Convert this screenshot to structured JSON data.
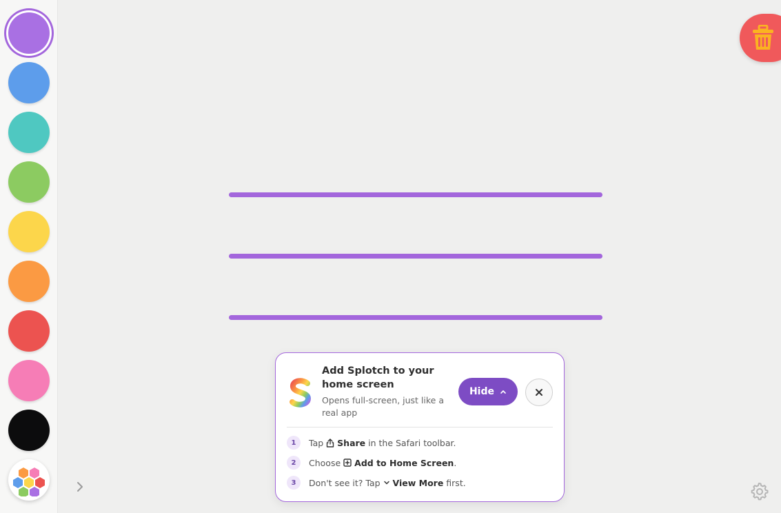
{
  "palette": {
    "swatches": [
      {
        "name": "purple",
        "color": "#a970e3",
        "selected": true
      },
      {
        "name": "blue",
        "color": "#5d9deb"
      },
      {
        "name": "teal",
        "color": "#4fc8c1"
      },
      {
        "name": "green",
        "color": "#8ccb61"
      },
      {
        "name": "yellow",
        "color": "#fcd64b"
      },
      {
        "name": "orange",
        "color": "#fb9a43"
      },
      {
        "name": "red",
        "color": "#ec5350"
      },
      {
        "name": "pink",
        "color": "#f67db6"
      },
      {
        "name": "black",
        "color": "#0c0c0d"
      }
    ],
    "custom_swatch_icon": "hexagon-color-wheel-icon",
    "expand_icon": "chevron-right-icon"
  },
  "canvas": {
    "stroke_color": "#a366dc",
    "strokes": 3
  },
  "trash": {
    "icon": "trash-icon",
    "color": "#f0595b",
    "icon_color": "#fbb321"
  },
  "settings": {
    "icon": "gear-icon"
  },
  "install_card": {
    "title": "Add Splotch to your home screen",
    "subtitle": "Opens full-screen, just like a real app",
    "hide_label": "Hide",
    "close_icon": "close-icon",
    "steps": [
      {
        "num": "1",
        "pre": "Tap",
        "icon": "share-icon",
        "bold": "Share",
        "post": "in the Safari toolbar."
      },
      {
        "num": "2",
        "pre": "Choose",
        "icon": "add-square-icon",
        "bold": "Add to Home Screen",
        "post": "."
      },
      {
        "num": "3",
        "pre": "Don't see it? Tap",
        "icon": "chevron-down-icon",
        "bold": "View More",
        "post": "first."
      }
    ]
  }
}
